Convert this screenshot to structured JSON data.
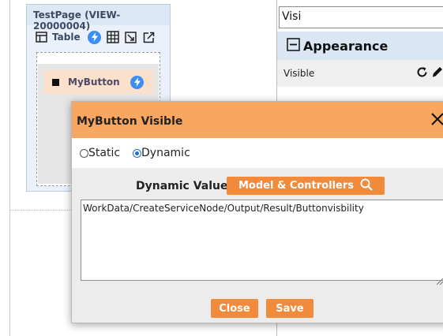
{
  "canvas": {
    "page_title": "TestPage (VIEW-20000004)",
    "toolbar_label": "Table",
    "component_label": "MyButton"
  },
  "properties": {
    "search_value": "Visi",
    "section_title": "Appearance",
    "row_label": "Visible"
  },
  "modal": {
    "title": "MyButton Visible",
    "options": [
      "Static",
      "Dynamic"
    ],
    "selected": "Dynamic",
    "dynamic_label": "Dynamic Value",
    "model_button": "Model & Controllers",
    "value": "WorkData/CreateServiceNode/Output/Result/Buttonvisbility",
    "close_label": "Close",
    "save_label": "Save"
  },
  "colors": {
    "modal_header": "#f9a661",
    "action_button": "#f28a3c",
    "bolt_badge": "#3d8ef0",
    "section_header": "#dbe6f4"
  }
}
